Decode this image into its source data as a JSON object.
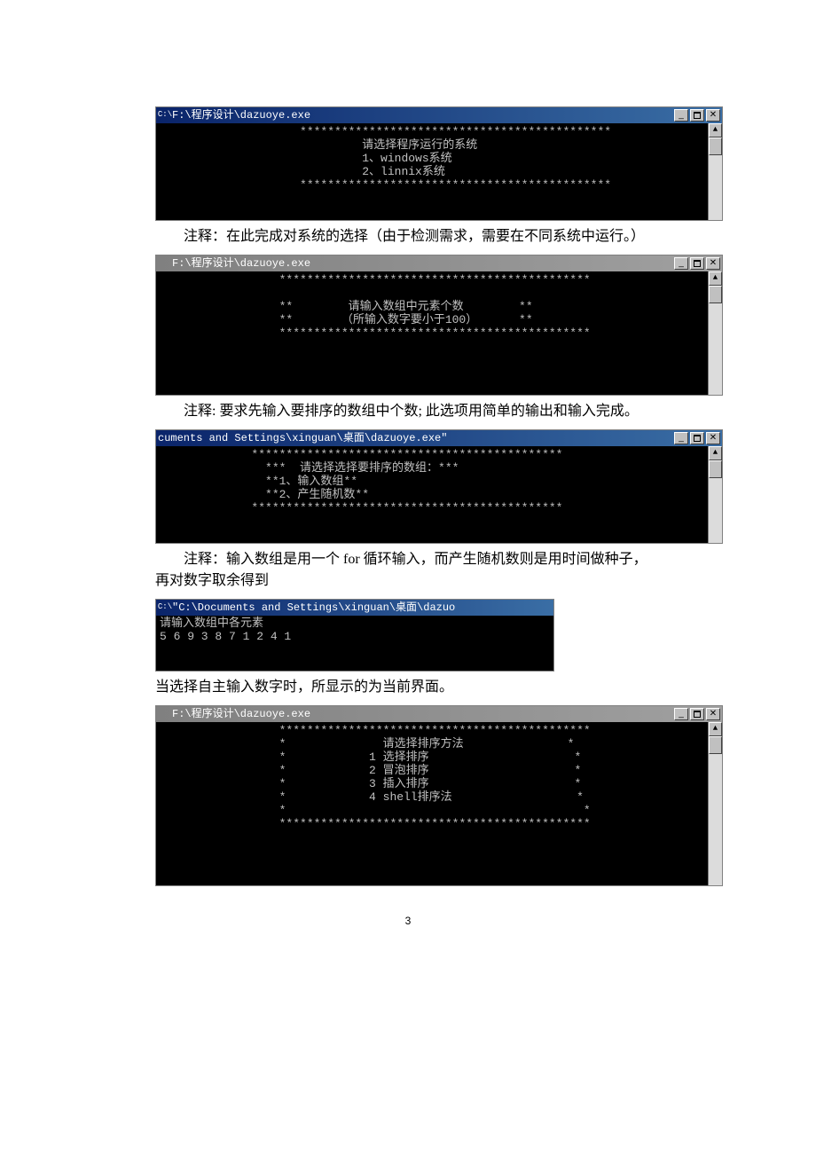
{
  "page_number": "3",
  "win1": {
    "title": "F:\\程序设计\\dazuoye.exe",
    "icon": "C:\\",
    "lines": [
      "                    *********************************************",
      "                             请选择程序运行的系统",
      "                             1、windows系统",
      "                             2、linnix系统",
      "                    *********************************************",
      "",
      "",
      ""
    ]
  },
  "note1": "注释：在此完成对系统的选择（由于检测需求，需要在不同系统中运行。）",
  "win2": {
    "title": "F:\\程序设计\\dazuoye.exe",
    "lines": [
      "                 *********************************************",
      "",
      "                 **        请输入数组中元素个数        **",
      "                 **       （所输入数字要小于100）      **",
      "                 *********************************************",
      "",
      "",
      "",
      "",
      ""
    ]
  },
  "note2": "注释: 要求先输入要排序的数组中个数; 此选项用简单的输出和输入完成。",
  "win3": {
    "title": "cuments and Settings\\xinguan\\桌面\\dazuoye.exe\"",
    "lines": [
      "             *********************************************",
      "               ***  请选择选择要排序的数组：***",
      "               **1、输入数组**",
      "               **2、产生随机数**",
      "             *********************************************",
      "",
      "",
      ""
    ]
  },
  "note3": "注释：输入数组是用一个 for 循环输入，而产生随机数则是用时间做种子，再对数字取余得到",
  "win4": {
    "title": "\"C:\\Documents and Settings\\xinguan\\桌面\\dazuo",
    "icon": "C:\\",
    "lines": [
      "请输入数组中各元素",
      "5 6 9 3 8 7 1 2 4 1",
      "",
      "",
      ""
    ]
  },
  "note4": "当选择自主输入数字时，所显示的为当前界面。",
  "win5": {
    "title": "F:\\程序设计\\dazuoye.exe",
    "lines": [
      "                 *********************************************",
      "                 *              请选择排序方法               *",
      "                 *            1 选择排序                     *",
      "                 *            2 冒泡排序                     *",
      "                 *            3 插入排序                     *",
      "                 *            4 shell排序法                  *",
      "                 *                                           *",
      "                 *********************************************",
      "",
      "",
      "",
      "",
      ""
    ]
  }
}
